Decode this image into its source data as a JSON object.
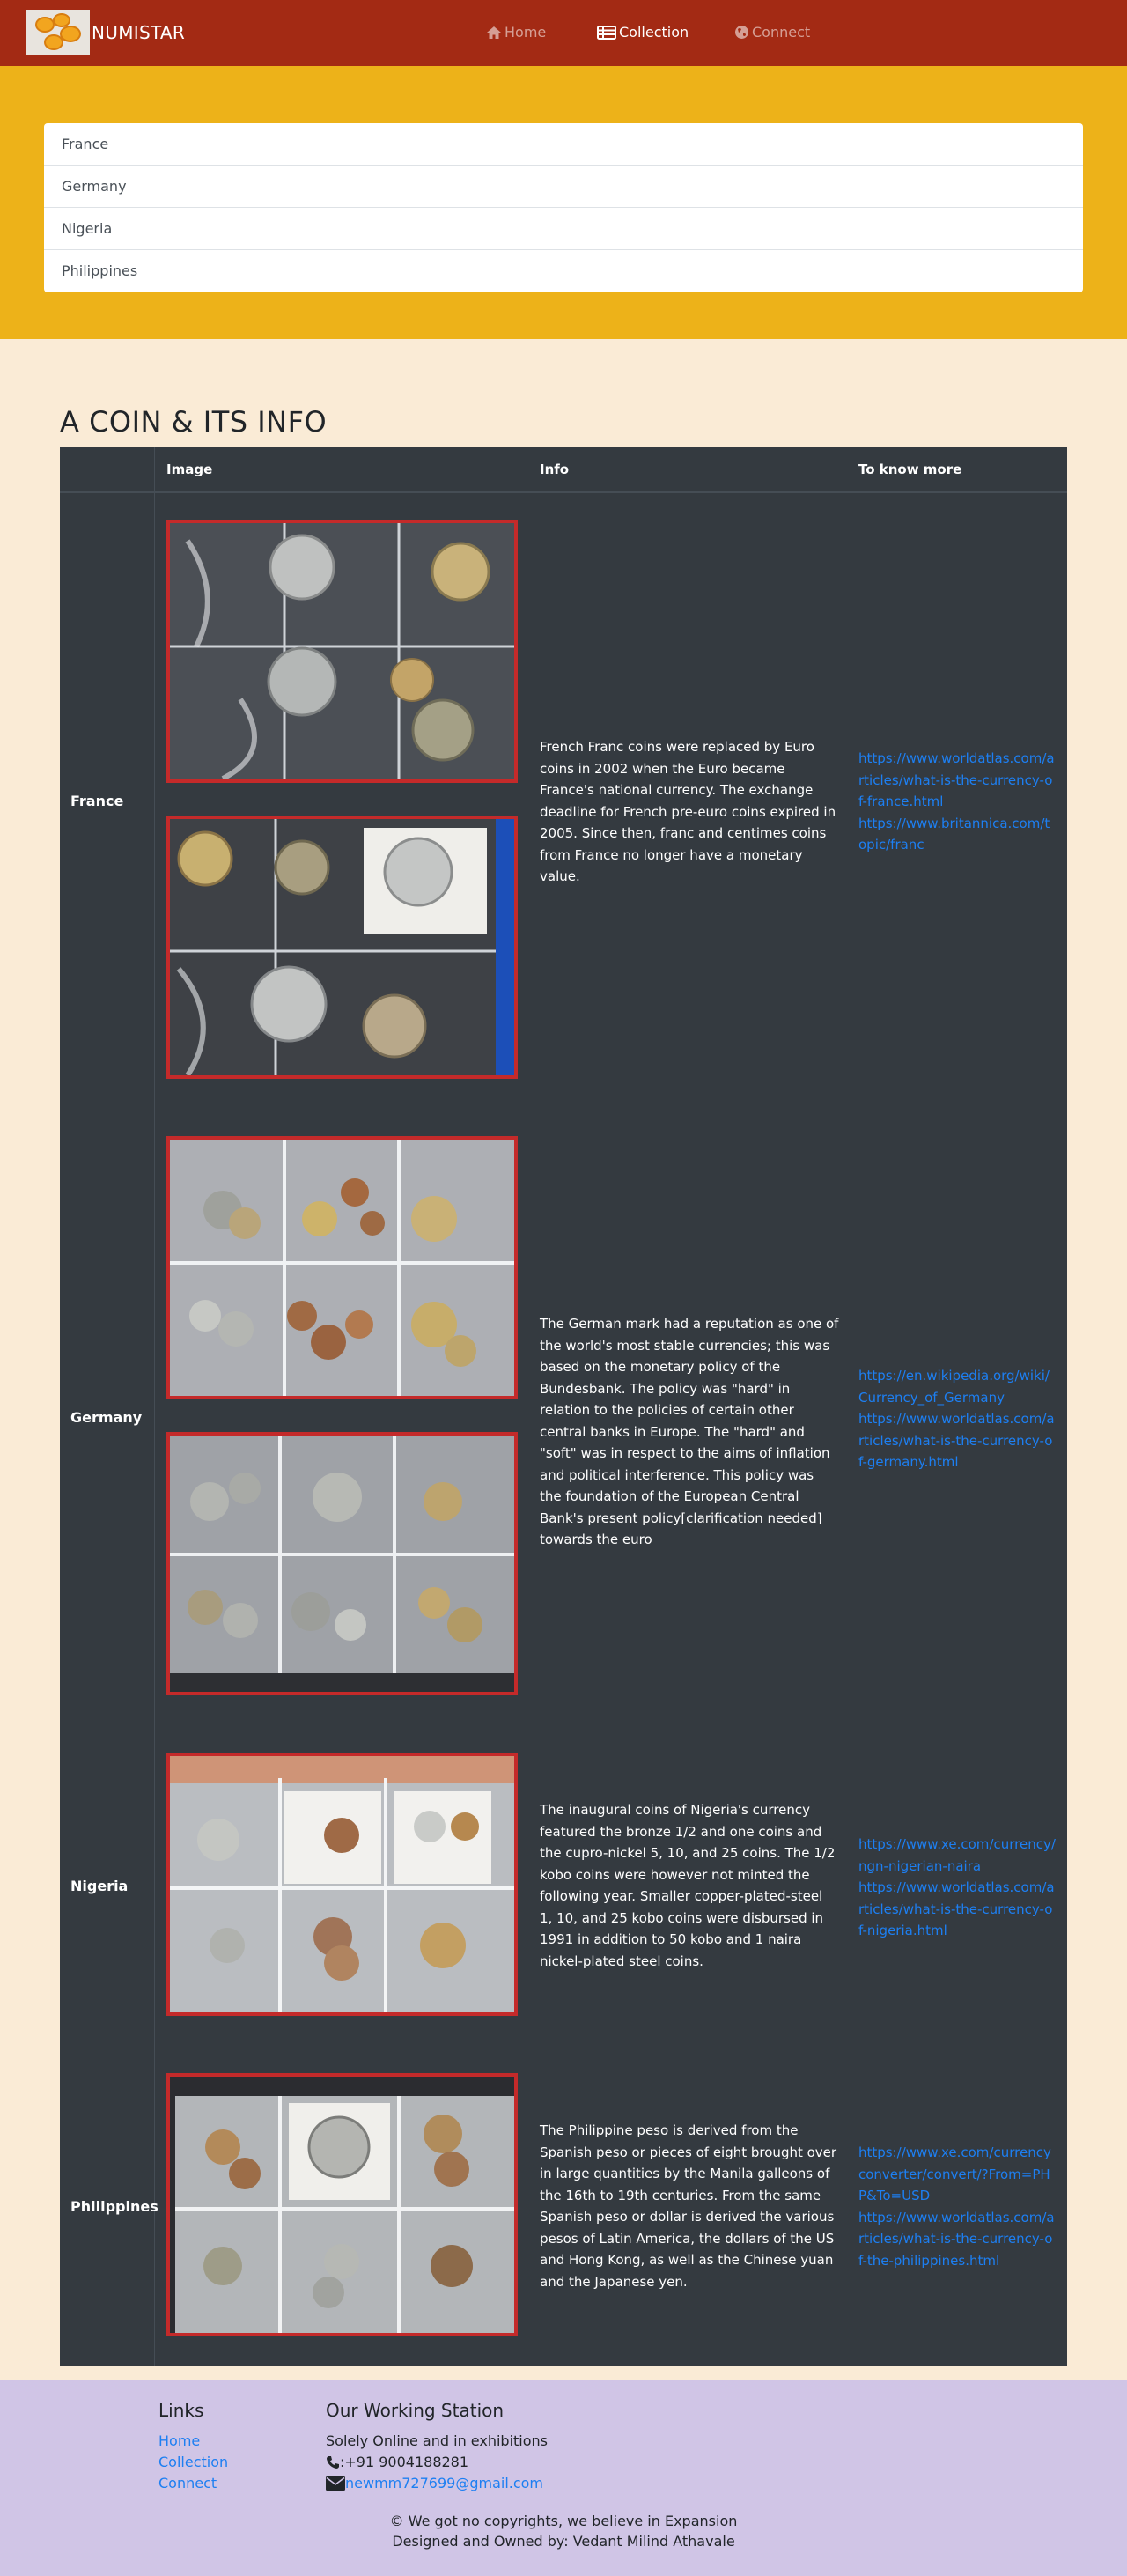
{
  "app": {
    "brand": "NUMISTAR"
  },
  "nav": {
    "items": [
      {
        "label": "Home",
        "icon": "home-icon"
      },
      {
        "label": "Collection",
        "icon": "table-icon"
      },
      {
        "label": "Connect",
        "icon": "globe-icon"
      }
    ],
    "active": "Collection"
  },
  "country_list": [
    "France",
    "Germany",
    "Nigeria",
    "Philippines"
  ],
  "section_title": "A COIN & ITS INFO",
  "table": {
    "headers": [
      "Image",
      "Info",
      "To know more"
    ],
    "rows": [
      {
        "country": "France",
        "images": [
          "france-coins-photo-1",
          "france-coins-photo-2"
        ],
        "info": "French Franc coins were replaced by Euro coins in 2002 when the Euro became France's national currency. The exchange deadline for French pre-euro coins expired in 2005. Since then, franc and centimes coins from France no longer have a monetary value.",
        "links": [
          "https://www.worldatlas.com/articles/what-is-the-currency-of-france.html",
          "https://www.britannica.com/topic/franc"
        ]
      },
      {
        "country": "Germany",
        "images": [
          "germany-coins-photo-1",
          "germany-coins-photo-2"
        ],
        "info": "The German mark had a reputation as one of the world's most stable currencies; this was based on the monetary policy of the Bundesbank. The policy was \"hard\" in relation to the policies of certain other central banks in Europe. The \"hard\" and \"soft\" was in respect to the aims of inflation and political interference. This policy was the foundation of the European Central Bank's present policy[clarification needed] towards the euro",
        "links": [
          "https://en.wikipedia.org/wiki/Currency_of_Germany",
          "https://www.worldatlas.com/articles/what-is-the-currency-of-germany.html"
        ]
      },
      {
        "country": "Nigeria",
        "images": [
          "nigeria-coins-photo"
        ],
        "info": "The inaugural coins of Nigeria's currency featured the bronze 1/2 and one coins and the cupro-nickel 5, 10, and 25 coins. The 1/2 kobo coins were however not minted the following year. Smaller copper-plated-steel 1, 10, and 25 kobo coins were disbursed in 1991 in addition to 50 kobo and 1 naira nickel-plated steel coins.",
        "links": [
          "https://www.xe.com/currency/ngn-nigerian-naira",
          "https://www.worldatlas.com/articles/what-is-the-currency-of-nigeria.html"
        ]
      },
      {
        "country": "Philippines",
        "images": [
          "philippines-coins-photo"
        ],
        "info": "The Philippine peso is derived from the Spanish peso or pieces of eight brought over in large quantities by the Manila galleons of the 16th to 19th centuries. From the same Spanish peso or dollar is derived the various pesos of Latin America, the dollars of the US and Hong Kong, as well as the Chinese yuan and the Japanese yen.",
        "links": [
          "https://www.xe.com/currencyconverter/convert/?From=PHP&To=USD",
          "https://www.worldatlas.com/articles/what-is-the-currency-of-the-philippines.html"
        ]
      }
    ]
  },
  "footer": {
    "links_title": "Links",
    "links": [
      "Home",
      "Collection",
      "Connect"
    ],
    "station_title": "Our Working Station",
    "station_text": "Solely Online and in exhibitions",
    "phone": ":+91 9004188281",
    "email": "newmm727699@gmail.com",
    "copyright": "© We got no copyrights, we believe in Expansion",
    "designed": "Designed and Owned by: Vedant Milind Athavale"
  },
  "colors": {
    "navbar": "#a32a14",
    "hero": "#edb219",
    "page": "#faebd6",
    "table": "#343a40",
    "photo_border": "#c42a2a",
    "link": "#1d7ff2",
    "footer": "#d0c5e6"
  }
}
